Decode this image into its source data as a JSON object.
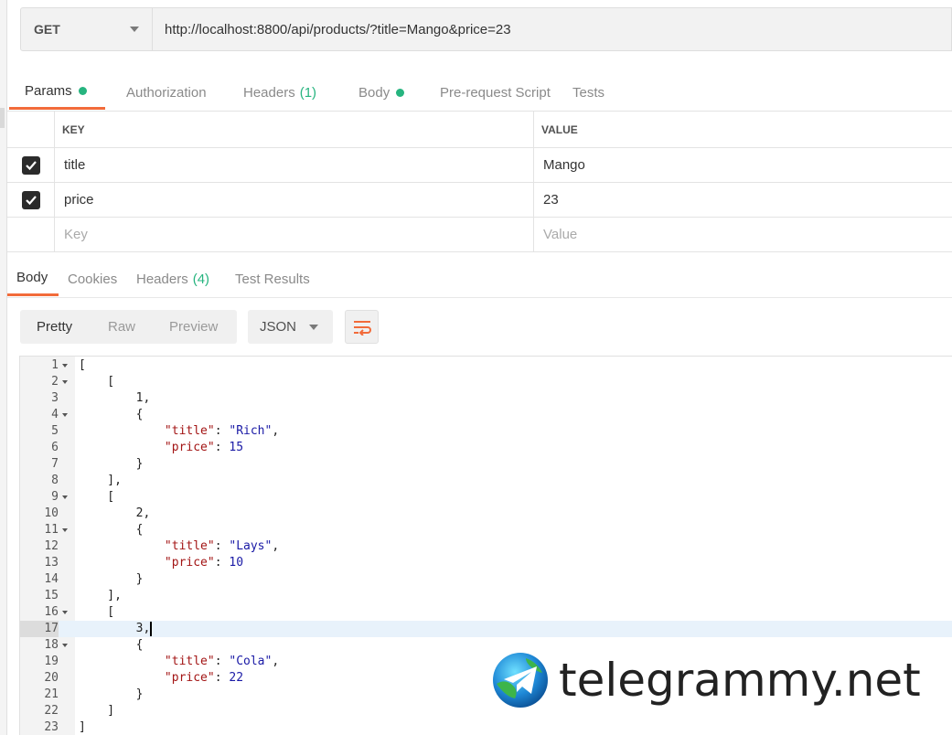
{
  "request": {
    "method": "GET",
    "url": "http://localhost:8800/api/products/?title=Mango&price=23"
  },
  "request_tabs": [
    {
      "label": "Params",
      "active": true,
      "dot": true
    },
    {
      "label": "Authorization"
    },
    {
      "label": "Headers",
      "count": "(1)"
    },
    {
      "label": "Body",
      "dot": true
    },
    {
      "label": "Pre-request Script"
    },
    {
      "label": "Tests"
    }
  ],
  "params": {
    "header_key": "KEY",
    "header_value": "VALUE",
    "rows": [
      {
        "key": "title",
        "value": "Mango",
        "checked": true
      },
      {
        "key": "price",
        "value": "23",
        "checked": true
      }
    ],
    "placeholder_key": "Key",
    "placeholder_value": "Value"
  },
  "response_tabs": [
    {
      "label": "Body",
      "active": true
    },
    {
      "label": "Cookies"
    },
    {
      "label": "Headers",
      "count": "(4)"
    },
    {
      "label": "Test Results"
    }
  ],
  "response_toolbar": {
    "views": [
      "Pretty",
      "Raw",
      "Preview"
    ],
    "active_view": "Pretty",
    "format": "JSON"
  },
  "code": {
    "highlighted_line": 17,
    "lines": [
      {
        "n": "1",
        "fold": true,
        "text": "["
      },
      {
        "n": "2",
        "fold": true,
        "text": "    ["
      },
      {
        "n": "3",
        "text": "        1,"
      },
      {
        "n": "4",
        "fold": true,
        "text": "        {"
      },
      {
        "n": "5",
        "text": "            \"title\": \"Rich\","
      },
      {
        "n": "6",
        "text": "            \"price\": 15"
      },
      {
        "n": "7",
        "text": "        }"
      },
      {
        "n": "8",
        "text": "    ],"
      },
      {
        "n": "9",
        "fold": true,
        "text": "    ["
      },
      {
        "n": "10",
        "text": "        2,"
      },
      {
        "n": "11",
        "fold": true,
        "text": "        {"
      },
      {
        "n": "12",
        "text": "            \"title\": \"Lays\","
      },
      {
        "n": "13",
        "text": "            \"price\": 10"
      },
      {
        "n": "14",
        "text": "        }"
      },
      {
        "n": "15",
        "text": "    ],"
      },
      {
        "n": "16",
        "fold": true,
        "text": "    ["
      },
      {
        "n": "17",
        "text": "        3,"
      },
      {
        "n": "18",
        "fold": true,
        "text": "        {"
      },
      {
        "n": "19",
        "text": "            \"title\": \"Cola\","
      },
      {
        "n": "20",
        "text": "            \"price\": 22"
      },
      {
        "n": "21",
        "text": "        }"
      },
      {
        "n": "22",
        "text": "    ]"
      },
      {
        "n": "23",
        "text": "]"
      }
    ]
  },
  "watermark": {
    "text": "telegrammy.net",
    "icon": "telegram-globe-icon"
  },
  "colors": {
    "accent": "#f26b3a",
    "dot_green": "#26b47f",
    "line_highlight": "#e8f2fb"
  }
}
